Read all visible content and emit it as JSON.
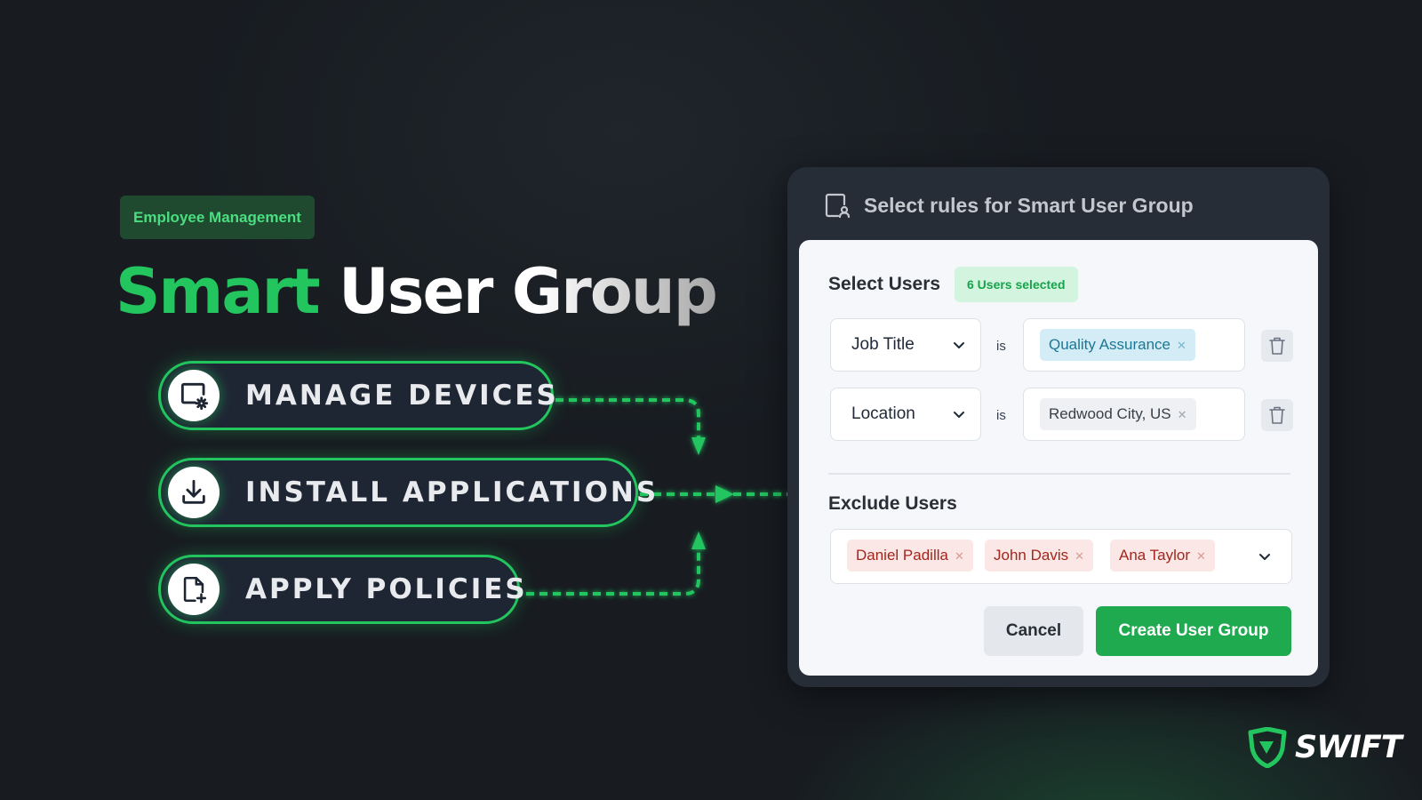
{
  "hero": {
    "badge": "Employee Management",
    "title_accent": "Smart",
    "title_rest": " User Group"
  },
  "features": [
    {
      "label": "MANAGE DEVICES",
      "icon": "device-settings-icon"
    },
    {
      "label": "INSTALL APPLICATIONS",
      "icon": "download-icon"
    },
    {
      "label": "APPLY POLICIES",
      "icon": "file-add-icon"
    }
  ],
  "dialog": {
    "title": "Select rules for Smart User Group",
    "title_icon": "user-device-icon",
    "select_users": {
      "heading": "Select Users",
      "count_badge": "6 Users selected",
      "rules": [
        {
          "field": "Job Title",
          "operator": "is",
          "values": [
            "Quality Assurance"
          ],
          "chip_color": "blue"
        },
        {
          "field": "Location",
          "operator": "is",
          "values": [
            "Redwood City, US"
          ],
          "chip_color": "gray"
        }
      ]
    },
    "exclude_users": {
      "heading": "Exclude Users",
      "chips": [
        "Daniel Padilla",
        "John Davis",
        "Ana Taylor"
      ]
    },
    "buttons": {
      "cancel": "Cancel",
      "create": "Create User Group"
    }
  },
  "brand": {
    "name": "SWIFT",
    "logo": "shield-logo-icon"
  },
  "colors": {
    "background": "#181c21",
    "accent_green": "#22c55e",
    "button_green": "#1faa4f",
    "card_dark": "#262d37",
    "card_light": "#f5f7fa"
  }
}
